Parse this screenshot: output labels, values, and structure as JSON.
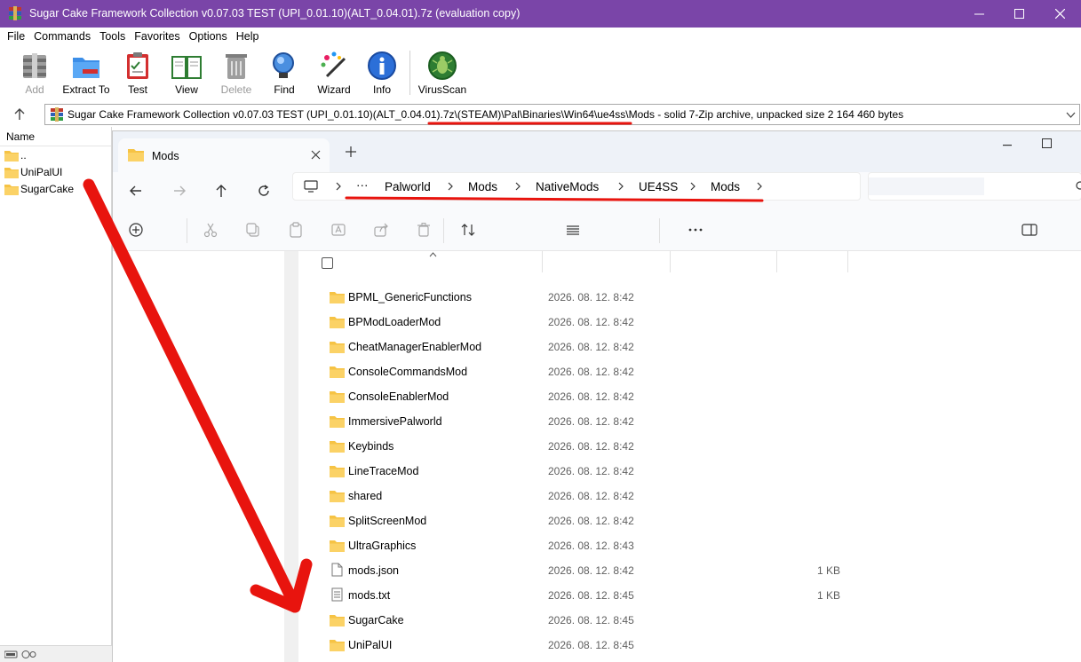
{
  "winrar": {
    "title": "Sugar Cake Framework Collection v0.07.03 TEST (UPI_0.01.10)(ALT_0.04.01).7z (evaluation copy)",
    "menu": [
      "File",
      "Commands",
      "Tools",
      "Favorites",
      "Options",
      "Help"
    ],
    "toolbar": {
      "add": "Add",
      "extract_to": "Extract To",
      "test": "Test",
      "view": "View",
      "delete": "Delete",
      "find": "Find",
      "wizard": "Wizard",
      "info": "Info",
      "virusscan": "VirusScan"
    },
    "address": {
      "archive": "Sugar Cake Framework Collection v0.07.03 TEST (UPI_0.01.10)(ALT_0.04.01).7z",
      "inner_path": "\\(STEAM)\\Pal\\Binaries\\Win64\\ue4ss\\Mods",
      "info": " - solid 7-Zip archive, unpacked size 2 164 460 bytes"
    },
    "sidebar": {
      "header": "Name",
      "items": [
        "..",
        "UniPalUI",
        "SugarCake"
      ]
    }
  },
  "explorer": {
    "tab_label": "Mods",
    "breadcrumb": {
      "ellipsis": "···",
      "items": [
        "Palworld",
        "Mods",
        "NativeMods",
        "UE4SS",
        "Mods"
      ]
    },
    "files": [
      {
        "name": "BPML_GenericFunctions",
        "date": "2026. 08. 12. 8:42",
        "size": "",
        "type": "folder"
      },
      {
        "name": "BPModLoaderMod",
        "date": "2026. 08. 12. 8:42",
        "size": "",
        "type": "folder"
      },
      {
        "name": "CheatManagerEnablerMod",
        "date": "2026. 08. 12. 8:42",
        "size": "",
        "type": "folder"
      },
      {
        "name": "ConsoleCommandsMod",
        "date": "2026. 08. 12. 8:42",
        "size": "",
        "type": "folder"
      },
      {
        "name": "ConsoleEnablerMod",
        "date": "2026. 08. 12. 8:42",
        "size": "",
        "type": "folder"
      },
      {
        "name": "ImmersivePalworld",
        "date": "2026. 08. 12. 8:42",
        "size": "",
        "type": "folder"
      },
      {
        "name": "Keybinds",
        "date": "2026. 08. 12. 8:42",
        "size": "",
        "type": "folder"
      },
      {
        "name": "LineTraceMod",
        "date": "2026. 08. 12. 8:42",
        "size": "",
        "type": "folder"
      },
      {
        "name": "shared",
        "date": "2026. 08. 12. 8:42",
        "size": "",
        "type": "folder"
      },
      {
        "name": "SplitScreenMod",
        "date": "2026. 08. 12. 8:42",
        "size": "",
        "type": "folder"
      },
      {
        "name": "UltraGraphics",
        "date": "2026. 08. 12. 8:43",
        "size": "",
        "type": "folder"
      },
      {
        "name": "mods.json",
        "date": "2026. 08. 12. 8:42",
        "size": "1 KB",
        "type": "json"
      },
      {
        "name": "mods.txt",
        "date": "2026. 08. 12. 8:45",
        "size": "1 KB",
        "type": "txt"
      },
      {
        "name": "SugarCake",
        "date": "2026. 08. 12. 8:45",
        "size": "",
        "type": "folder"
      },
      {
        "name": "UniPalUI",
        "date": "2026. 08. 12. 8:45",
        "size": "",
        "type": "folder"
      }
    ]
  },
  "colors": {
    "titlebar": "#7a45a8",
    "folder": "#f6c344",
    "annotation": "#e8140e"
  }
}
